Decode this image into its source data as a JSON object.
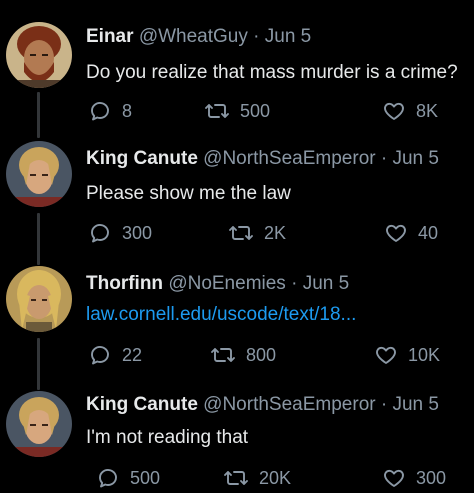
{
  "tweets": [
    {
      "name": "Einar",
      "handle": "@WheatGuy",
      "separator": "·",
      "date": "Jun 5",
      "text": "Do you realize that mass murder is a crime?",
      "is_link": false,
      "replies": "8",
      "retweets": "500",
      "likes": "8K",
      "avatar": {
        "skin": "#b27a52",
        "hair": "#7a2f17",
        "bg": "#c9b48a"
      }
    },
    {
      "name": "King Canute",
      "handle": "@NorthSeaEmperor",
      "separator": "·",
      "date": "Jun 5",
      "text": "Please show me the law",
      "is_link": false,
      "replies": "300",
      "retweets": "2K",
      "likes": "40",
      "avatar": {
        "skin": "#d7a77e",
        "hair": "#c9a45c",
        "bg": "#4a5563"
      }
    },
    {
      "name": "Thorfinn",
      "handle": "@NoEnemies",
      "separator": "·",
      "date": "Jun 5",
      "text": "law.cornell.edu/uscode/text/18...",
      "is_link": true,
      "replies": "22",
      "retweets": "800",
      "likes": "10K",
      "avatar": {
        "skin": "#c99a6e",
        "hair": "#d9b85e",
        "bg": "#b89a58"
      }
    },
    {
      "name": "King Canute",
      "handle": "@NorthSeaEmperor",
      "separator": "·",
      "date": "Jun 5",
      "text": "I'm not reading that",
      "is_link": false,
      "replies": "500",
      "retweets": "20K",
      "likes": "300",
      "avatar": {
        "skin": "#d7a77e",
        "hair": "#c9a45c",
        "bg": "#4a5563"
      }
    }
  ],
  "icons": {
    "reply": "reply-icon",
    "retweet": "retweet-icon",
    "like": "heart-icon"
  },
  "colors": {
    "background": "#000000",
    "text": "#e7e9ea",
    "muted": "#8b98a5",
    "link": "#1d9bf0",
    "thread_line": "#333639"
  }
}
